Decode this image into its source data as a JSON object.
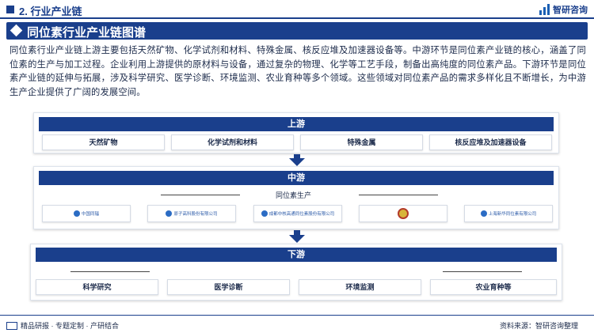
{
  "header": {
    "section": "2. 行业产业链",
    "brand": "智研咨询"
  },
  "title": "同位素行业产业链图谱",
  "intro": "同位素行业产业链上游主要包括天然矿物、化学试剂和材料、特殊金属、核反应堆及加速器设备等。中游环节是同位素产业链的核心，涵盖了同位素的生产与加工过程。企业利用上游提供的原材料与设备，通过复杂的物理、化学等工艺手段，制备出高纯度的同位素产品。下游环节是同位素产业链的延伸与拓展，涉及科学研究、医学诊断、环境监测、农业育种等多个领域。这些领域对同位素产品的需求多样化且不断增长，为中游生产企业提供了广阔的发展空间。",
  "upstream": {
    "label": "上游",
    "items": [
      "天然矿物",
      "化学试剂和材料",
      "特殊金属",
      "核反应堆及加速器设备"
    ]
  },
  "midstream": {
    "label": "中游",
    "sublabel": "同位素生产",
    "logos": [
      "中国同辐",
      "原子高科股份有限公司",
      "成都中核高通同位素股份有限公司",
      "",
      "上海新华同位素有限公司"
    ]
  },
  "downstream": {
    "label": "下游",
    "items": [
      "科学研究",
      "医学诊断",
      "环境监测",
      "农业育种等"
    ]
  },
  "footer": {
    "tagline": "精品研报 · 专题定制 · 产研结合",
    "source": "资料来源：智研咨询整理"
  },
  "colors": {
    "primary": "#1a3f8c",
    "text": "#1b2a4a",
    "border": "#d5dbe5"
  }
}
